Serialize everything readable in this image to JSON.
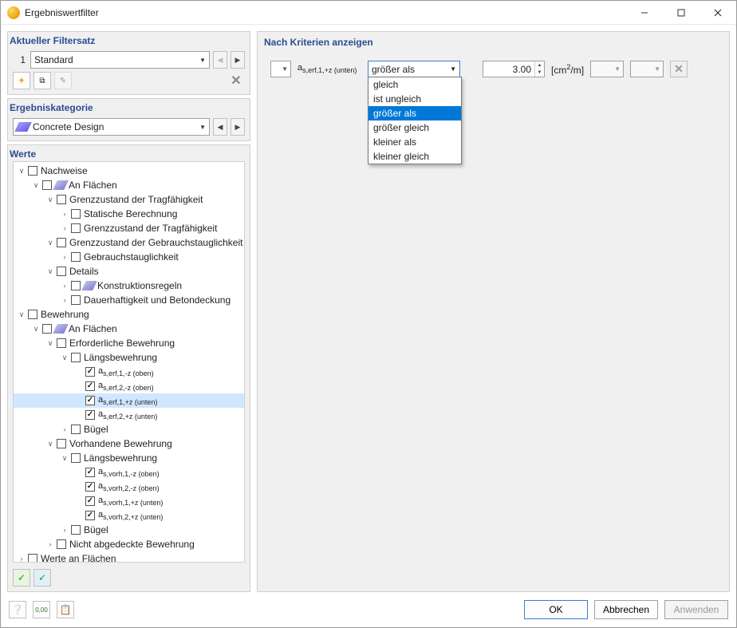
{
  "window": {
    "title": "Ergebniswertfilter"
  },
  "filterset": {
    "heading": "Aktueller Filtersatz",
    "index": "1",
    "name": "Standard"
  },
  "category": {
    "heading": "Ergebniskategorie",
    "name": "Concrete Design"
  },
  "values": {
    "heading": "Werte",
    "tree": {
      "nachweise": "Nachweise",
      "an_flaechen": "An Flächen",
      "gz_trag": "Grenzzustand der Tragfähigkeit",
      "stat_berech": "Statische Berechnung",
      "gz_gebrauchst": "Grenzzustand der Gebrauchstauglichkeit",
      "gebrauchst": "Gebrauchstauglichkeit",
      "details": "Details",
      "konstrukt": "Konstruktionsregeln",
      "dauerhaft": "Dauerhaftigkeit und Betondeckung",
      "bewehrung": "Bewehrung",
      "erf_bew": "Erforderliche Bewehrung",
      "laengsbew": "Längsbewehrung",
      "a_erf_1_mz_o": "as,erf,1,-z (oben)",
      "a_erf_2_mz_o": "as,erf,2,-z (oben)",
      "a_erf_1_pz_u": "as,erf,1,+z (unten)",
      "a_erf_2_pz_u": "as,erf,2,+z (unten)",
      "buegel": "Bügel",
      "vorh_bew": "Vorhandene Bewehrung",
      "a_vorh_1_mz_o": "as,vorh,1,-z (oben)",
      "a_vorh_2_mz_o": "as,vorh,2,-z (oben)",
      "a_vorh_1_pz_u": "as,vorh,1,+z (unten)",
      "a_vorh_2_pz_u": "as,vorh,2,+z (unten)",
      "nicht_abg": "Nicht abgedeckte Bewehrung",
      "werte_an_fl": "Werte an Flächen"
    }
  },
  "criteria": {
    "heading": "Nach Kriterien anzeigen",
    "param_label": "as,erf,1,+z (unten)",
    "operator_selected": "größer als",
    "operators": [
      "gleich",
      "ist ungleich",
      "größer als",
      "größer gleich",
      "kleiner als",
      "kleiner gleich"
    ],
    "value": "3.00",
    "unit_html": "[cm²/m]"
  },
  "buttons": {
    "ok": "OK",
    "cancel": "Abbrechen",
    "apply": "Anwenden"
  }
}
